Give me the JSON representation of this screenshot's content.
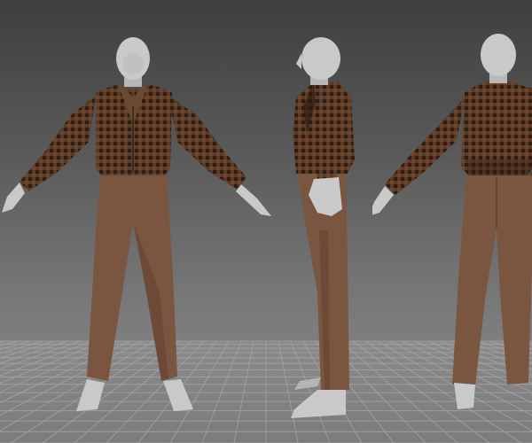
{
  "scene": {
    "view_names": [
      "front-view",
      "side-view",
      "back-view"
    ],
    "colors": {
      "background_top": "#3f3f3f",
      "background_bottom": "#8a8a8a",
      "grid_line": "#9a9a9a",
      "skin": "#c9c9c9",
      "skin_shadow": "#a9a9a9",
      "shirt_base": "#5a3a26",
      "shirt_check_dark": "#2e1d13",
      "shirt_check_light": "#7a4f33",
      "pants": "#7a5540",
      "pants_shadow": "#5f4030",
      "undershirt": "#6b4a34"
    }
  }
}
